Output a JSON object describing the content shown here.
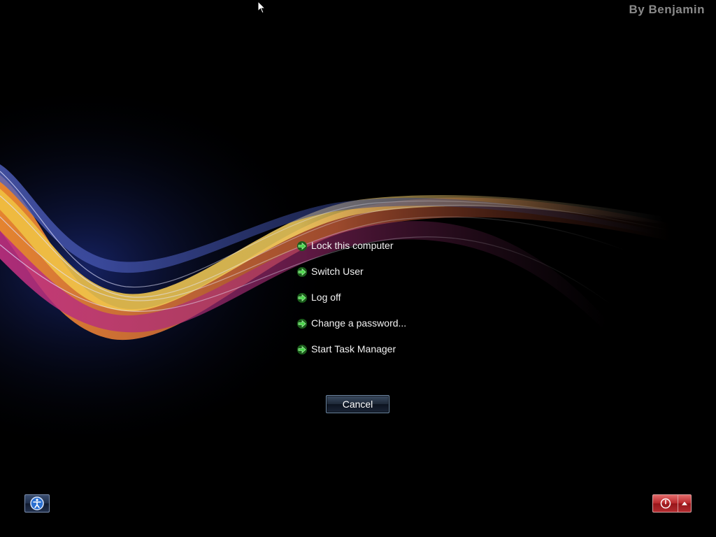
{
  "watermark": "By Benjamin",
  "menu": {
    "items": [
      {
        "label": "Lock this computer"
      },
      {
        "label": "Switch User"
      },
      {
        "label": "Log off"
      },
      {
        "label": "Change a password..."
      },
      {
        "label": "Start Task Manager"
      }
    ],
    "arrow_icon": "green-arrow-icon",
    "arrow_color": "#3fcf3f"
  },
  "cancel_label": "Cancel",
  "ease_of_access": {
    "icon": "ease-of-access-icon"
  },
  "power": {
    "icon": "power-icon",
    "options_icon": "caret-up-icon",
    "color": "#b8262a"
  },
  "colors": {
    "background": "#000000",
    "wave_yellow": "#f4c93a",
    "wave_orange": "#e8772a",
    "wave_pink": "#c0307a",
    "wave_blue": "#3a4fa0"
  }
}
